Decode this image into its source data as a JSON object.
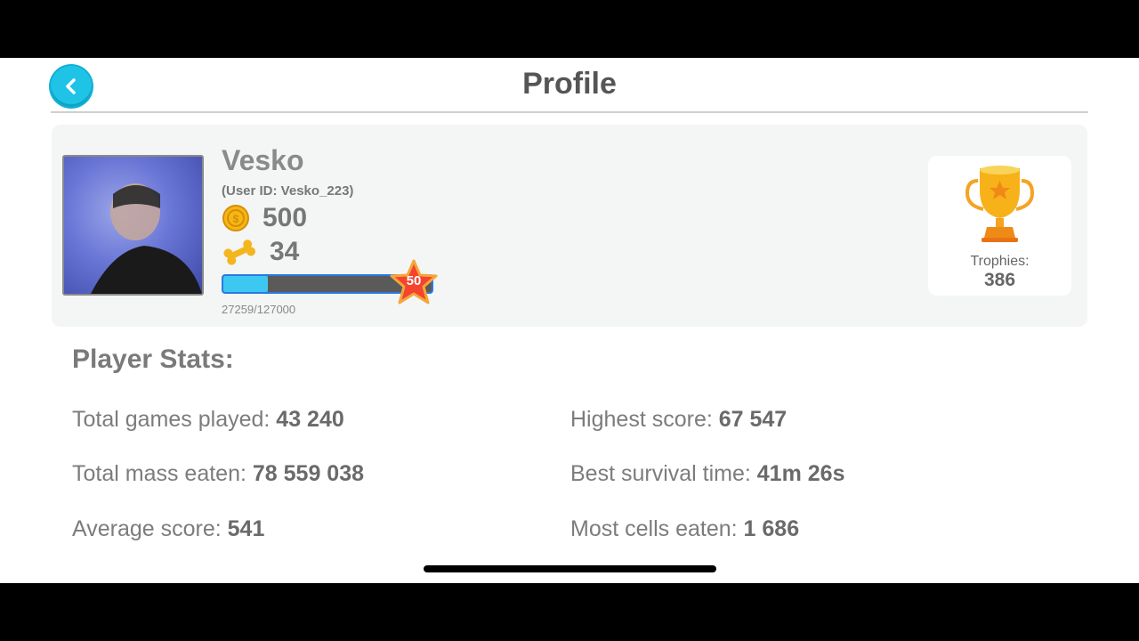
{
  "header": {
    "title": "Profile"
  },
  "profile": {
    "name": "Vesko",
    "user_id": "(User ID: Vesko_223)",
    "coins": "500",
    "bones": "34",
    "xp_text": "27259/127000",
    "xp_progress": 0.2146,
    "level": "50"
  },
  "trophies": {
    "label": "Trophies:",
    "value": "386"
  },
  "stats": {
    "title": "Player Stats:",
    "items": [
      {
        "label": "Total games played: ",
        "value": "43 240"
      },
      {
        "label": "Highest score: ",
        "value": "67 547"
      },
      {
        "label": "Total mass eaten: ",
        "value": "78 559 038"
      },
      {
        "label": "Best survival time: ",
        "value": "41m 26s"
      },
      {
        "label": "Average score: ",
        "value": "541"
      },
      {
        "label": "Most cells eaten: ",
        "value": "1 686"
      }
    ]
  },
  "colors": {
    "accent": "#1fc3e6",
    "xp_fill": "#3dc8f2",
    "card_bg": "#f4f5f5",
    "star": "#f4442e",
    "trophy": "#f7b21a"
  }
}
